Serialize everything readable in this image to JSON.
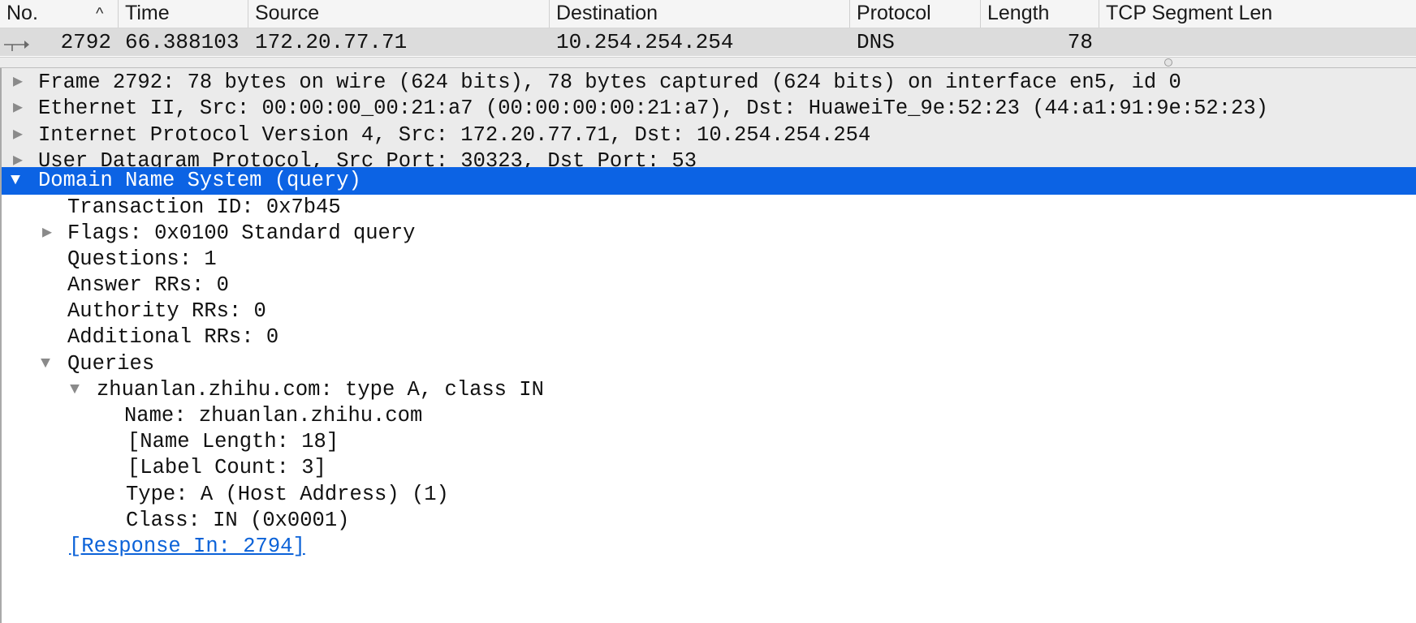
{
  "packet_list": {
    "columns": [
      "No.",
      "Time",
      "Source",
      "Destination",
      "Protocol",
      "Length",
      "TCP Segment Len"
    ],
    "sort_indicator": "^",
    "row": {
      "no": "2792",
      "time": "66.388103",
      "source": "172.20.77.71",
      "destination": "10.254.254.254",
      "protocol": "DNS",
      "length": "78",
      "tcp_segment_len": ""
    }
  },
  "details": {
    "rows": [
      {
        "text": "Frame 2792: 78 bytes on wire (624 bits), 78 bytes captured (624 bits) on interface en5, id 0",
        "expander": "collapsed"
      },
      {
        "text": "Ethernet II, Src: 00:00:00_00:21:a7 (00:00:00:00:21:a7), Dst: HuaweiTe_9e:52:23 (44:a1:91:9e:52:23)",
        "expander": "collapsed"
      },
      {
        "text": "Internet Protocol Version 4, Src: 172.20.77.71, Dst: 10.254.254.254",
        "expander": "collapsed"
      },
      {
        "text": "User Datagram Protocol, Src Port: 30323, Dst Port: 53",
        "expander": "collapsed"
      },
      {
        "text": "Domain Name System (query)",
        "expander": "expanded",
        "selected": true
      },
      {
        "text": "Transaction ID: 0x7b45",
        "expander": "none"
      },
      {
        "text": "Flags: 0x0100 Standard query",
        "expander": "collapsed"
      },
      {
        "text": "Questions: 1",
        "expander": "none"
      },
      {
        "text": "Answer RRs: 0",
        "expander": "none"
      },
      {
        "text": "Authority RRs: 0",
        "expander": "none"
      },
      {
        "text": "Additional RRs: 0",
        "expander": "none"
      },
      {
        "text": "Queries",
        "expander": "expanded"
      },
      {
        "text": "zhuanlan.zhihu.com: type A, class IN",
        "expander": "expanded"
      },
      {
        "text": "Name: zhuanlan.zhihu.com",
        "expander": "none"
      },
      {
        "text": "[Name Length: 18]",
        "expander": "none"
      },
      {
        "text": "[Label Count: 3]",
        "expander": "none"
      },
      {
        "text": "Type: A (Host Address) (1)",
        "expander": "none"
      },
      {
        "text": "Class: IN (0x0001)",
        "expander": "none"
      },
      {
        "text": "[Response In: 2794]",
        "expander": "none",
        "link": true
      }
    ],
    "glyphs": {
      "collapsed": "▶",
      "expanded": "▼"
    }
  },
  "colors": {
    "selection": "#0c63e4",
    "link": "#0b62d8",
    "band": "#ebebeb",
    "selected_packet_row": "#dcdcdc"
  }
}
